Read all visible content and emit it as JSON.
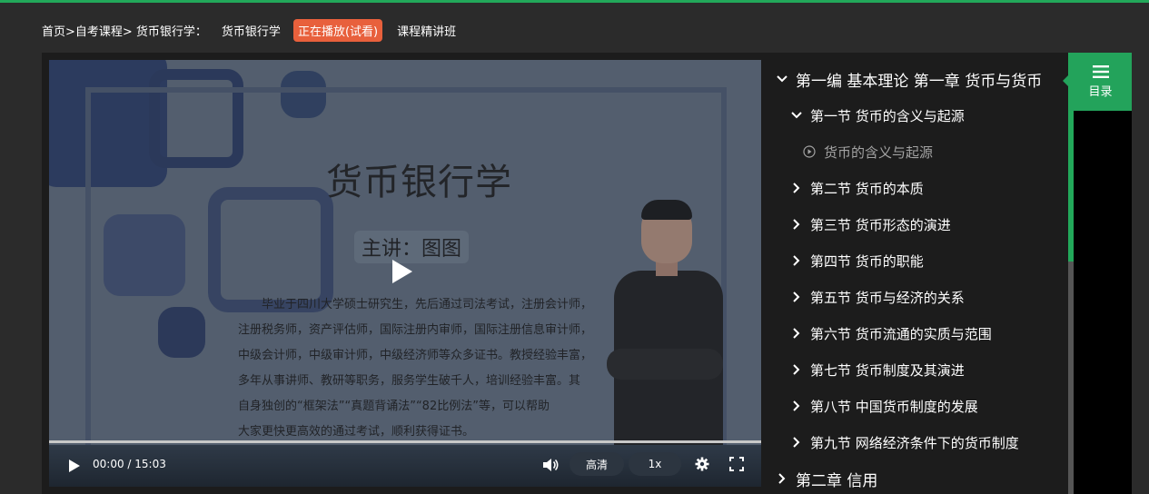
{
  "breadcrumb": {
    "path": "首页>自考课程> 货币银行学：",
    "course": "货币银行学",
    "badge": "正在播放(试看)",
    "class_name": "课程精讲班"
  },
  "video": {
    "slide": {
      "title": "货币银行学",
      "teacher": "主讲：图图",
      "bio_lines": [
        "毕业于四川大学硕士研究生，先后通过司法考试，注册会计师，",
        "注册税务师，资产评估师，国际注册内审师，国际注册信息审计师，",
        "中级会计师，中级审计师，中级经济师等众多证书。教授经验丰富，",
        "多年从事讲师、教研等职务，服务学生破千人，培训经验丰富。其",
        "自身独创的“框架法”“真题背诵法”“82比例法”等，可以帮助",
        "大家更快更高效的通过考试，顺利获得证书。"
      ]
    },
    "time": "00:00 / 15:03",
    "progress": 0.0,
    "quality": "高清",
    "speed": "1x"
  },
  "catalog": {
    "part": "第一编 基本理论 第一章 货币与货币",
    "sections": [
      "第一节 货币的含义与起源",
      "第二节 货币的本质",
      "第三节 货币形态的演进",
      "第四节 货币的职能",
      "第五节 货币与经济的关系",
      "第六节 货币流通的实质与范围",
      "第七节 货币制度及其演进",
      "第八节 中国货币制度的发展",
      "第九节 网络经济条件下的货币制度"
    ],
    "lesson": "货币的含义与起源",
    "next_chapter": "第二章 信用"
  },
  "menu": {
    "label": "目录"
  },
  "colors": {
    "accent": "#23a35b",
    "badge": "#e8603c"
  },
  "icons": [
    "play-icon",
    "volume-icon",
    "gear-icon",
    "fullscreen-icon",
    "chevron-down-icon",
    "chevron-right-icon",
    "play-circle-icon",
    "menu-icon"
  ]
}
